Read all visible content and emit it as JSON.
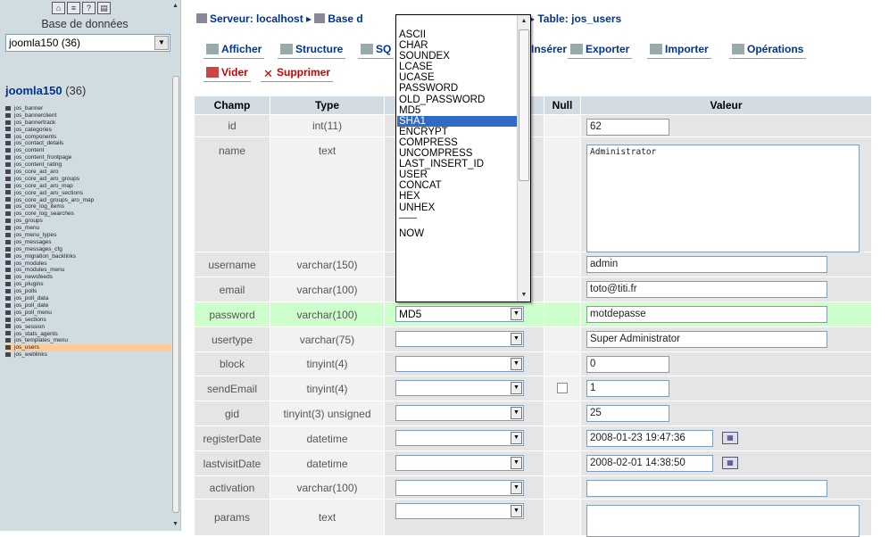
{
  "sidebar": {
    "icons": [
      "home-icon",
      "sql-icon",
      "docs-icon",
      "query-icon"
    ],
    "db_label": "Base de données",
    "db_select": "joomla150 (36)",
    "db_title": "joomla150",
    "db_count": "(36)",
    "tables": [
      "jos_banner",
      "jos_bannerclient",
      "jos_bannertrack",
      "jos_categories",
      "jos_components",
      "jos_contact_details",
      "jos_content",
      "jos_content_frontpage",
      "jos_content_rating",
      "jos_core_acl_aro",
      "jos_core_acl_aro_groups",
      "jos_core_acl_aro_map",
      "jos_core_acl_aro_sections",
      "jos_core_acl_groups_aro_map",
      "jos_core_log_items",
      "jos_core_log_searches",
      "jos_groups",
      "jos_menu",
      "jos_menu_types",
      "jos_messages",
      "jos_messages_cfg",
      "jos_migration_backlinks",
      "jos_modules",
      "jos_modules_menu",
      "jos_newsfeeds",
      "jos_plugins",
      "jos_polls",
      "jos_poll_data",
      "jos_poll_date",
      "jos_poll_menu",
      "jos_sections",
      "jos_session",
      "jos_stats_agents",
      "jos_templates_menu",
      "jos_users",
      "jos_weblinks"
    ],
    "active_table": "jos_users"
  },
  "breadcrumb": {
    "server": "Serveur: localhost",
    "base": "Base d",
    "table": "Table: jos_users"
  },
  "tabs": {
    "afficher": "Afficher",
    "structure": "Structure",
    "sql": "SQ",
    "inserer": "Insérer",
    "exporter": "Exporter",
    "importer": "Importer",
    "operations": "Opérations",
    "vider": "Vider",
    "supprimer": "Supprimer"
  },
  "headers": {
    "champ": "Champ",
    "type": "Type",
    "null": "Null",
    "valeur": "Valeur"
  },
  "rows": [
    {
      "field": "id",
      "type": "int(11)",
      "func": "",
      "value": "62"
    },
    {
      "field": "name",
      "type": "text",
      "func": "",
      "value": "Administrator"
    },
    {
      "field": "username",
      "type": "varchar(150)",
      "func": "",
      "value": "admin"
    },
    {
      "field": "email",
      "type": "varchar(100)",
      "func": "",
      "value": "toto@titi.fr"
    },
    {
      "field": "password",
      "type": "varchar(100)",
      "func": "MD5",
      "value": "motdepasse"
    },
    {
      "field": "usertype",
      "type": "varchar(75)",
      "func": "",
      "value": "Super Administrator"
    },
    {
      "field": "block",
      "type": "tinyint(4)",
      "func": "",
      "value": "0"
    },
    {
      "field": "sendEmail",
      "type": "tinyint(4)",
      "func": "",
      "value": "1"
    },
    {
      "field": "gid",
      "type": "tinyint(3) unsigned",
      "func": "",
      "value": "25"
    },
    {
      "field": "registerDate",
      "type": "datetime",
      "func": "",
      "value": "2008-01-23 19:47:36"
    },
    {
      "field": "lastvisitDate",
      "type": "datetime",
      "func": "",
      "value": "2008-02-01 14:38:50"
    },
    {
      "field": "activation",
      "type": "varchar(100)",
      "func": "",
      "value": ""
    },
    {
      "field": "params",
      "type": "text",
      "func": "",
      "value": ""
    }
  ],
  "dropdown": {
    "options": [
      "ASCII",
      "CHAR",
      "SOUNDEX",
      "LCASE",
      "UCASE",
      "PASSWORD",
      "OLD_PASSWORD",
      "MD5",
      "SHA1",
      "ENCRYPT",
      "COMPRESS",
      "UNCOMPRESS",
      "LAST_INSERT_ID",
      "USER",
      "CONCAT",
      "HEX",
      "UNHEX",
      "——",
      "NOW"
    ],
    "selected": "SHA1"
  },
  "colors": {
    "highlight_row": "#ccffcc",
    "header_bg": "#d3dce3",
    "row_light": "#f2f2f2",
    "row_dark": "#e5e5e5",
    "selection": "#3169c6",
    "link": "#003399"
  }
}
